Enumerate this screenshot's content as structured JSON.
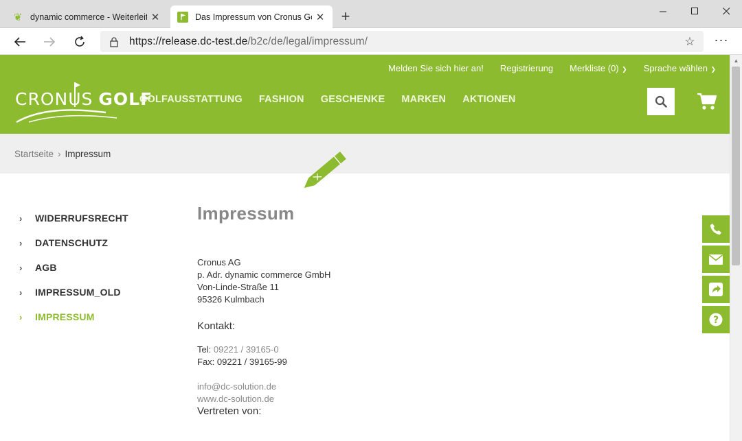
{
  "browser": {
    "tabs": [
      {
        "title": "dynamic commerce - Weiterleitung",
        "active": false
      },
      {
        "title": "Das Impressum von Cronus Golf",
        "active": true
      }
    ],
    "url_host": "https://release.dc-test.de",
    "url_path": "/b2c/de/legal/impressum/",
    "new_tab": "+",
    "more": "···"
  },
  "header": {
    "top_links": [
      "Melden Sie sich hier an!",
      "Registrierung",
      "Merkliste (0)",
      "Sprache wählen"
    ],
    "logo_left": "CRONUS",
    "logo_right": "GOLF",
    "main_nav": [
      "GOLFAUSSTATTUNG",
      "FASHION",
      "GESCHENKE",
      "MARKEN",
      "AKTIONEN"
    ]
  },
  "breadcrumb": {
    "home": "Startseite",
    "current": "Impressum"
  },
  "sidebar": {
    "items": [
      {
        "label": "WIDERRUFSRECHT",
        "active": false
      },
      {
        "label": "DATENSCHUTZ",
        "active": false
      },
      {
        "label": "AGB",
        "active": false
      },
      {
        "label": "IMPRESSUM_OLD",
        "active": false
      },
      {
        "label": "IMPRESSUM",
        "active": true
      }
    ]
  },
  "content": {
    "title": "Impressum",
    "address": [
      "Cronus AG",
      "p. Adr. dynamic commerce GmbH",
      "Von-Linde-Straße 11",
      "95326 Kulmbach"
    ],
    "contact_heading": "Kontakt:",
    "tel_label": "Tel:",
    "tel_value": "09221 / 39165-0",
    "fax": "Fax: 09221 / 39165-99",
    "email": "info@dc-solution.de",
    "website": "www.dc-solution.de",
    "represented_heading": "Vertreten von:"
  },
  "colors": {
    "brand_green": "#8dbb2f",
    "breadcrumb_bg": "#efefef"
  },
  "icons": {
    "float_buttons": [
      "phone-icon",
      "envelope-icon",
      "share-icon",
      "help-icon"
    ]
  }
}
